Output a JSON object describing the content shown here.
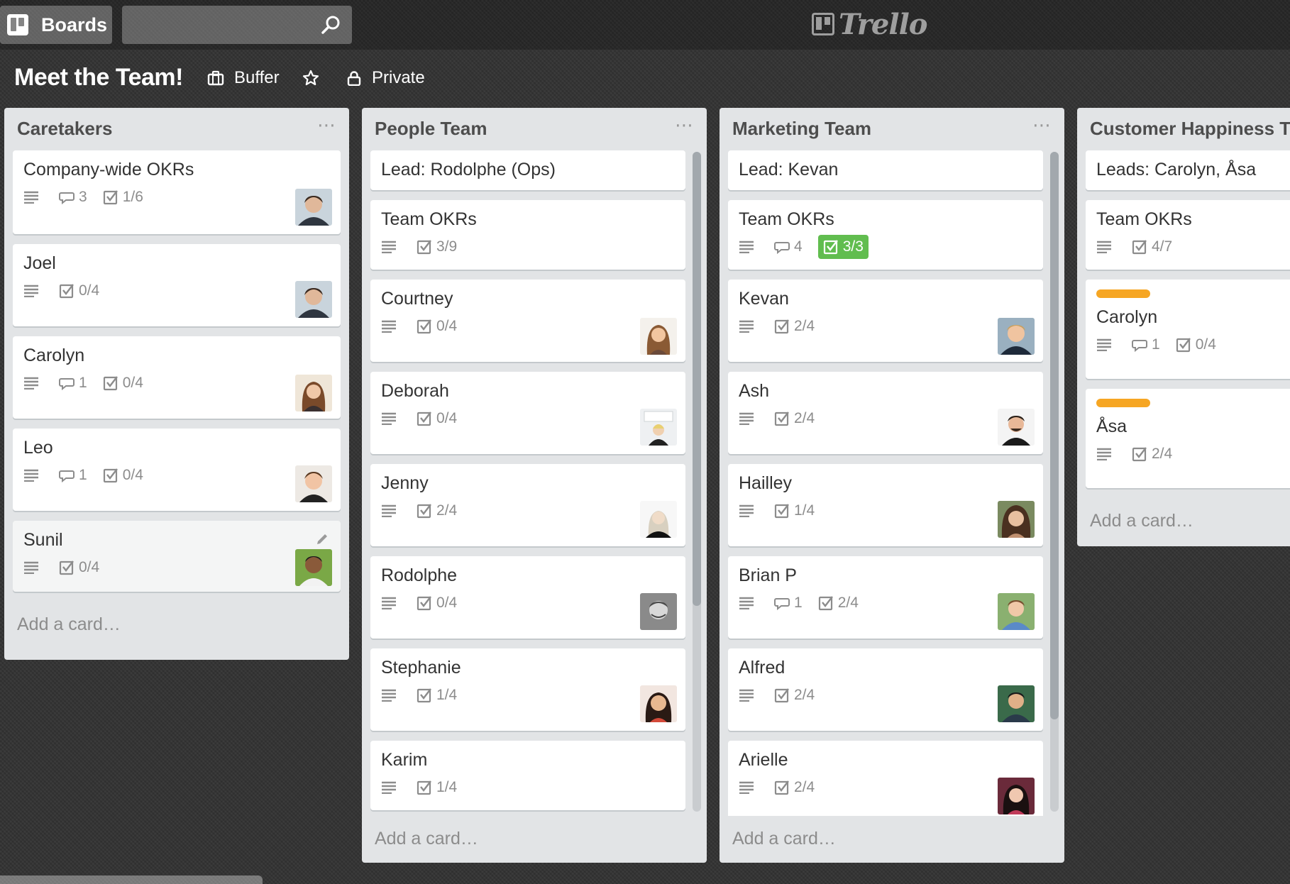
{
  "topbar": {
    "boards_label": "Boards",
    "search_placeholder": "",
    "logo_text": "Trello"
  },
  "board": {
    "title": "Meet the Team!",
    "team_label": "Buffer",
    "visibility_label": "Private"
  },
  "lists": [
    {
      "title": "Caretakers",
      "add_card": "Add a card…",
      "cards": [
        {
          "title": "Company-wide OKRs",
          "comments": "3",
          "checklist": "1/6",
          "avatar": "avatar-man-dark-hair"
        },
        {
          "title": "Joel",
          "comments": "",
          "checklist": "0/4",
          "avatar": "avatar-man-dark-hair"
        },
        {
          "title": "Carolyn",
          "comments": "1",
          "checklist": "0/4",
          "avatar": "avatar-woman-brown-hair"
        },
        {
          "title": "Leo",
          "comments": "1",
          "checklist": "0/4",
          "avatar": "avatar-man-smiling"
        },
        {
          "title": "Sunil",
          "comments": "",
          "checklist": "0/4",
          "avatar": "avatar-man-outdoor"
        }
      ]
    },
    {
      "title": "People Team",
      "add_card": "Add a card…",
      "cards": [
        {
          "title": "Lead: Rodolphe (Ops)"
        },
        {
          "title": "Team OKRs",
          "checklist": "3/9"
        },
        {
          "title": "Courtney",
          "checklist": "0/4",
          "avatar": "avatar-woman-smiling"
        },
        {
          "title": "Deborah",
          "checklist": "0/4",
          "avatar": "avatar-woman-whiteboard"
        },
        {
          "title": "Jenny",
          "checklist": "2/4",
          "avatar": "avatar-woman-blonde"
        },
        {
          "title": "Rodolphe",
          "checklist": "0/4",
          "avatar": "avatar-man-bw"
        },
        {
          "title": "Stephanie",
          "checklist": "1/4",
          "avatar": "avatar-woman-dark-hair"
        },
        {
          "title": "Karim",
          "checklist": "1/4"
        }
      ]
    },
    {
      "title": "Marketing Team",
      "add_card": "Add a card…",
      "cards": [
        {
          "title": "Lead: Kevan"
        },
        {
          "title": "Team OKRs",
          "comments": "4",
          "checklist": "3/3",
          "checklist_complete": true
        },
        {
          "title": "Kevan",
          "checklist": "2/4",
          "avatar": "avatar-man-blond"
        },
        {
          "title": "Ash",
          "checklist": "2/4",
          "avatar": "avatar-man-beard"
        },
        {
          "title": "Hailley",
          "checklist": "1/4",
          "avatar": "avatar-woman-long-hair"
        },
        {
          "title": "Brian P",
          "comments": "1",
          "checklist": "2/4",
          "avatar": "avatar-man-outdoor"
        },
        {
          "title": "Alfred",
          "checklist": "2/4",
          "avatar": "avatar-man-green"
        },
        {
          "title": "Arielle",
          "checklist": "2/4",
          "avatar": "avatar-woman-red"
        }
      ]
    },
    {
      "title": "Customer Happiness Team",
      "add_card": "Add a card…",
      "cards": [
        {
          "title": "Leads: Carolyn, Åsa"
        },
        {
          "title": "Team OKRs",
          "checklist": "4/7"
        },
        {
          "title": "Carolyn",
          "label_color": "#f6a623",
          "comments": "1",
          "checklist": "0/4"
        },
        {
          "title": "Åsa",
          "label_color": "#f6a623",
          "checklist": "2/4"
        }
      ]
    }
  ],
  "colors": {
    "background": "#333333",
    "list_bg": "#e2e4e6",
    "label_orange": "#f6a623",
    "checklist_complete": "#61bd4f"
  }
}
